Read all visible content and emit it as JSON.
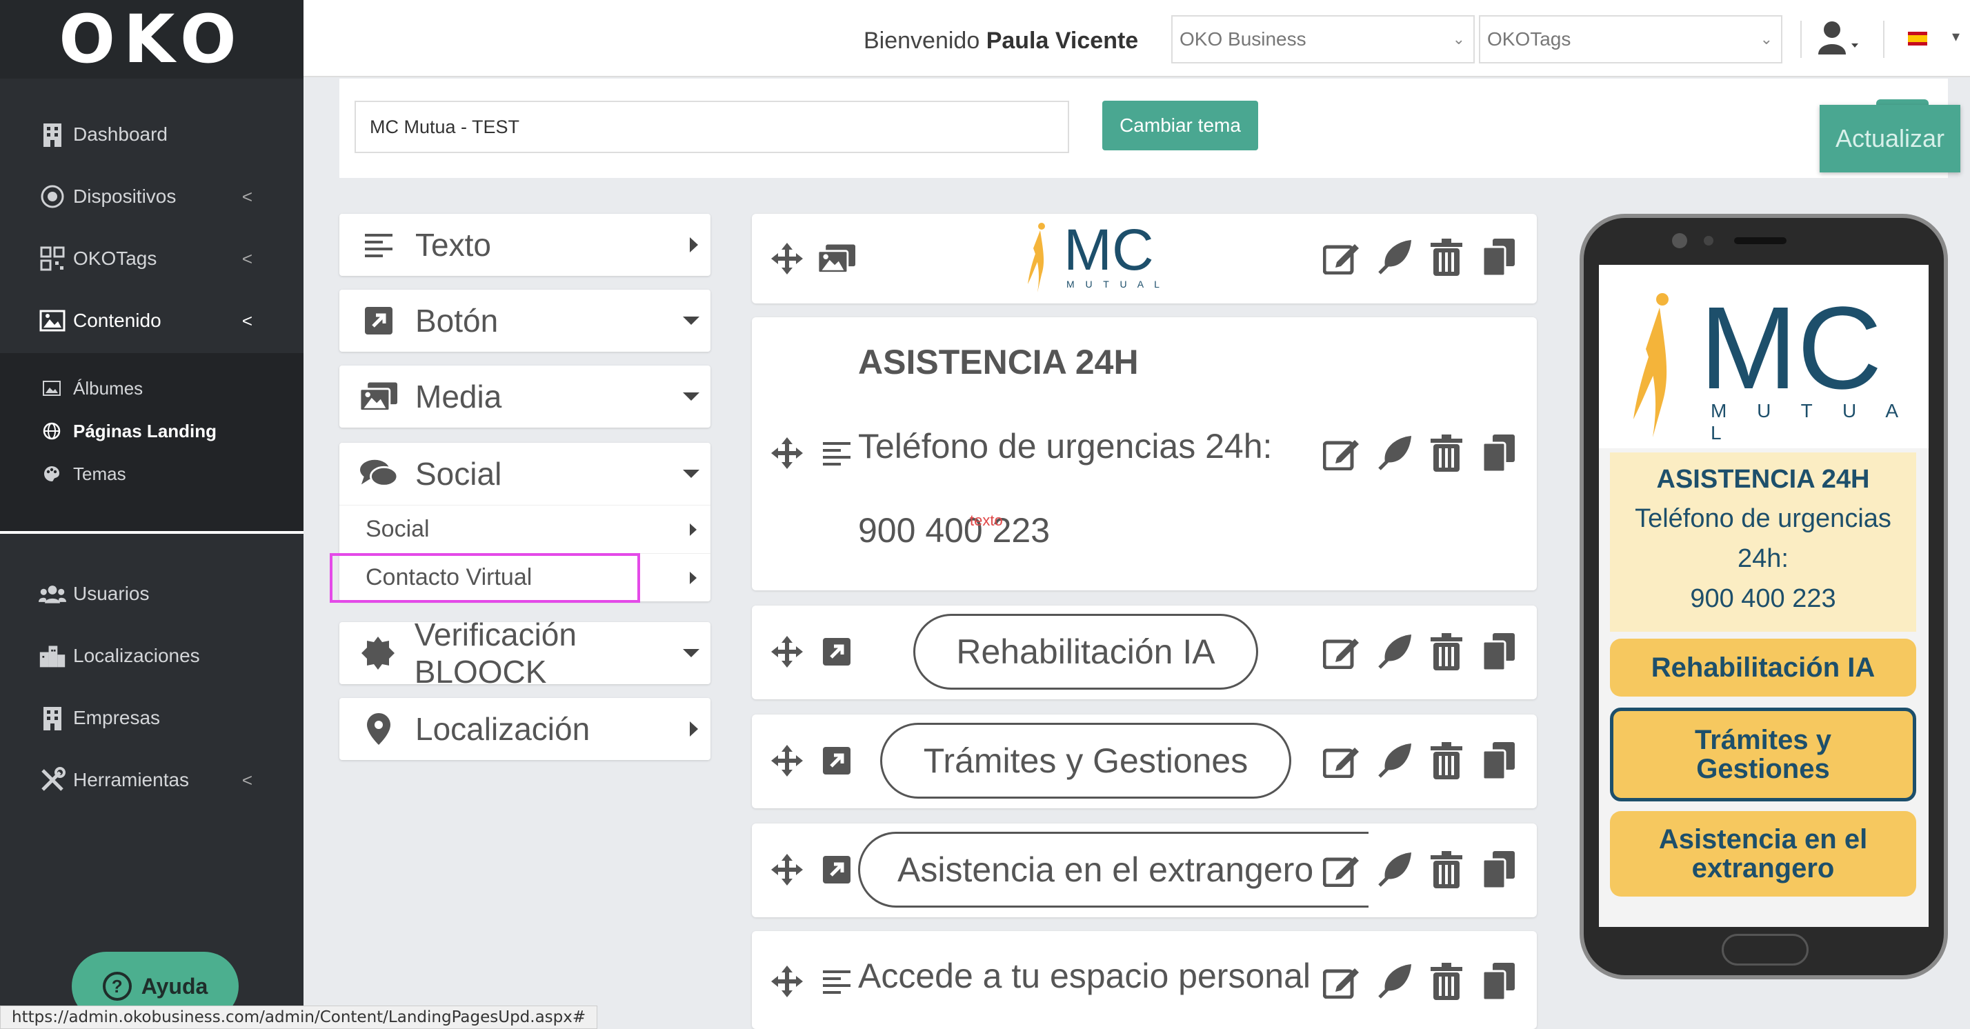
{
  "brand": {
    "logo": "OKO"
  },
  "sidebar": {
    "items": [
      {
        "label": "Dashboard",
        "icon": "building-icon"
      },
      {
        "label": "Dispositivos",
        "icon": "device-icon",
        "chevron": "<"
      },
      {
        "label": "OKOTags",
        "icon": "qr-icon",
        "chevron": "<"
      },
      {
        "label": "Contenido",
        "icon": "image-icon",
        "chevron": "<"
      }
    ],
    "submenu": [
      {
        "label": "Álbumes",
        "icon": "album-icon"
      },
      {
        "label": "Páginas Landing",
        "icon": "globe-icon"
      },
      {
        "label": "Temas",
        "icon": "palette-icon"
      }
    ],
    "items2": [
      {
        "label": "Usuarios",
        "icon": "users-icon"
      },
      {
        "label": "Localizaciones",
        "icon": "city-icon"
      },
      {
        "label": "Empresas",
        "icon": "building-icon"
      },
      {
        "label": "Herramientas",
        "icon": "tools-icon",
        "chevron": "<"
      }
    ],
    "help_label": "Ayuda",
    "help_icon": "?"
  },
  "status_url": "https://admin.okobusiness.com/admin/Content/LandingPagesUpd.aspx#",
  "header": {
    "welcome_prefix": "Bienvenido",
    "user_name": "Paula Vicente",
    "select1": "OKO Business",
    "select2": "OKOTags"
  },
  "topbar": {
    "page_name_value": "MC Mutua - TEST",
    "change_theme": "Cambiar tema",
    "update": "Actualizar"
  },
  "widgets": {
    "texto": "Texto",
    "boton": "Botón",
    "media": "Media",
    "social": "Social",
    "social_sub": [
      "Social",
      "Contacto Virtual"
    ],
    "verificacion": "Verificación BLOOCK",
    "localizacion": "Localización"
  },
  "blocks": {
    "logo_mc": "MC",
    "logo_mutual": "M U T U A L",
    "asist_title": "ASISTENCIA 24H",
    "asist_line1": "Teléfono de urgencias 24h:",
    "asist_line2": "900 400 223",
    "texto_mark": "texto",
    "btn1": "Rehabilitación IA",
    "btn2": "Trámites y Gestiones",
    "btn3": "Asistencia en el extrangero",
    "text5": "Accede a tu espacio personal"
  },
  "phone": {
    "logo_mc": "MC",
    "logo_mutual": "M U T U A L",
    "card_title": "ASISTENCIA 24H",
    "card_line1": "Teléfono de urgencias 24h:",
    "card_line2": "900 400 223",
    "btn1": "Rehabilitación IA",
    "btn2": "Trámites y Gestiones",
    "btn3": "Asistencia en el extrangero"
  },
  "colors": {
    "sidebar_bg": "#2c2f33",
    "accent_green": "#4aa791",
    "brand_navy": "#1d4f6b",
    "brand_yellow": "#f6c85f",
    "highlight_magenta": "#e44ae8"
  }
}
